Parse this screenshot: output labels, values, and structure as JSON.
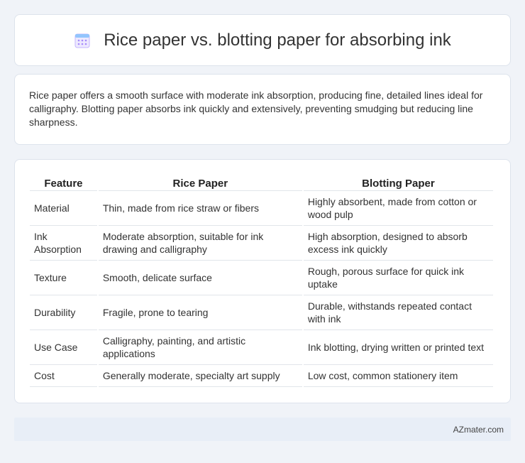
{
  "header": {
    "title": "Rice paper vs. blotting paper for absorbing ink",
    "icon": "calendar-icon",
    "icon_color": "#a78bfa"
  },
  "intro": {
    "text": "Rice paper offers a smooth surface with moderate ink absorption, producing fine, detailed lines ideal for calligraphy. Blotting paper absorbs ink quickly and extensively, preventing smudging but reducing line sharpness."
  },
  "table": {
    "columns": [
      "Feature",
      "Rice Paper",
      "Blotting Paper"
    ],
    "rows": [
      [
        "Material",
        "Thin, made from rice straw or fibers",
        "Highly absorbent, made from cotton or wood pulp"
      ],
      [
        "Ink Absorption",
        "Moderate absorption, suitable for ink drawing and calligraphy",
        "High absorption, designed to absorb excess ink quickly"
      ],
      [
        "Texture",
        "Smooth, delicate surface",
        "Rough, porous surface for quick ink uptake"
      ],
      [
        "Durability",
        "Fragile, prone to tearing",
        "Durable, withstands repeated contact with ink"
      ],
      [
        "Use Case",
        "Calligraphy, painting, and artistic applications",
        "Ink blotting, drying written or printed text"
      ],
      [
        "Cost",
        "Generally moderate, specialty art supply",
        "Low cost, common stationery item"
      ]
    ]
  },
  "footer": {
    "brand": "AZmater.com"
  }
}
